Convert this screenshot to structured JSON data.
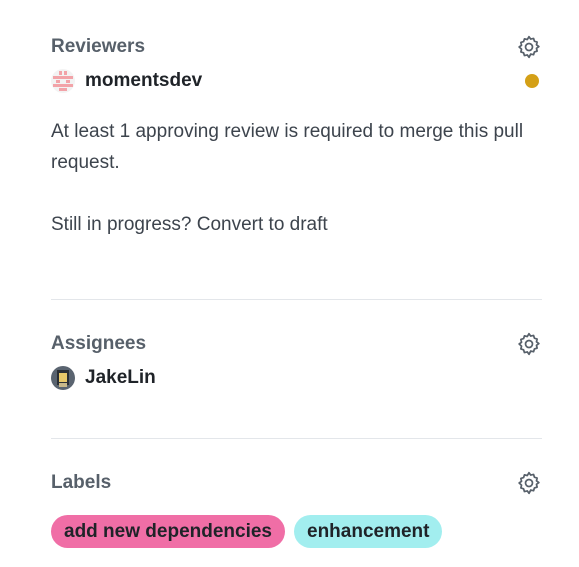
{
  "reviewers": {
    "title": "Reviewers",
    "reviewer": {
      "name": "momentsdev",
      "status_color": "#d4a017"
    },
    "notice": "At least 1 approving review is required to merge this pull request.",
    "draft_prompt_prefix": "Still in progress? ",
    "draft_link": "Convert to draft"
  },
  "assignees": {
    "title": "Assignees",
    "assignee": {
      "name": "JakeLin"
    }
  },
  "labels": {
    "title": "Labels",
    "items": [
      {
        "text": "add new dependencies",
        "color": "#f06ea6"
      },
      {
        "text": "enhancement",
        "color": "#a2eeef"
      }
    ]
  },
  "icons": {
    "gear": "gear-icon"
  }
}
